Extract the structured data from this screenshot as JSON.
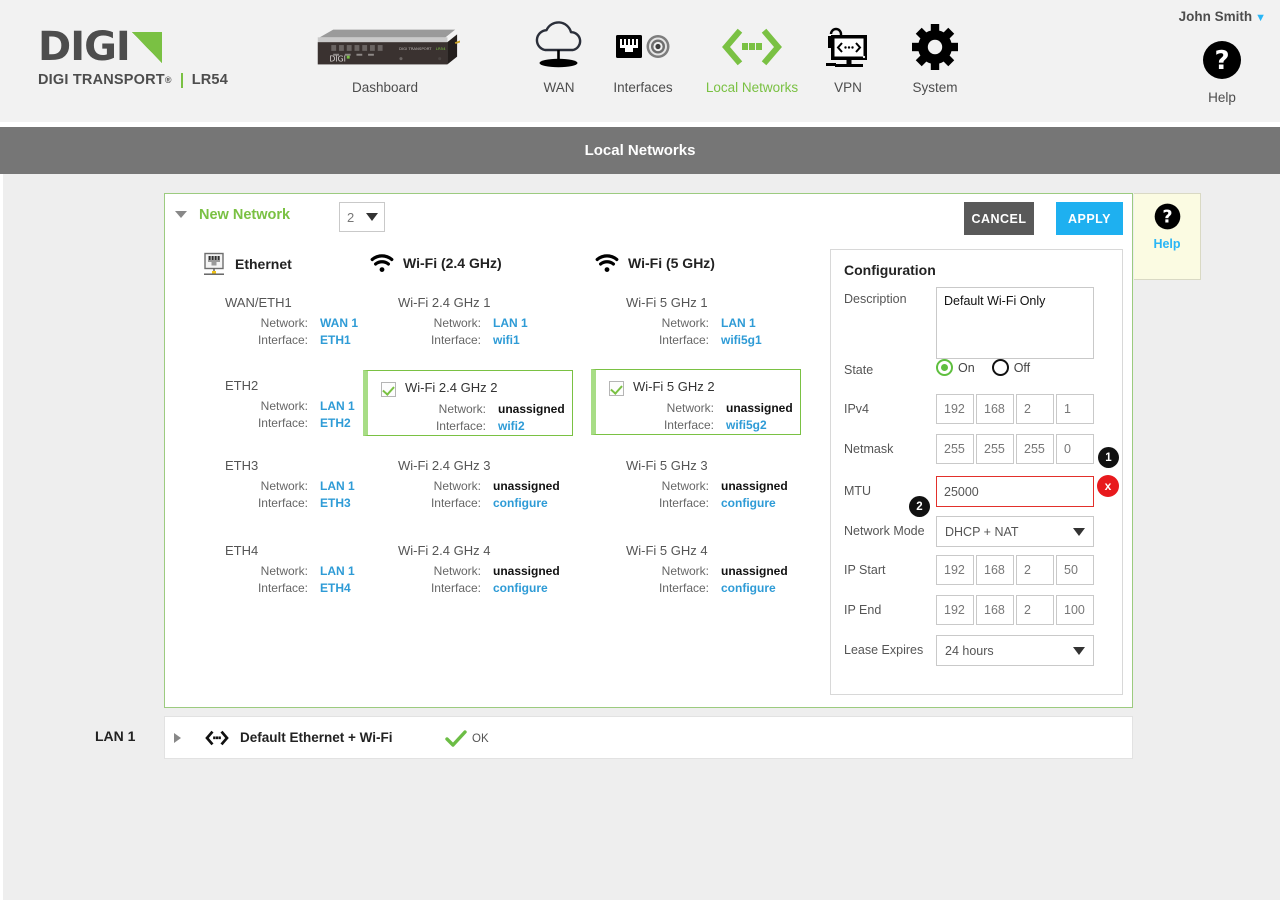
{
  "brand": {
    "word": "DIGI",
    "sub_main": "DIGI TRANSPORT",
    "sub_reg": "®",
    "sub_model": "LR54"
  },
  "header": {
    "user": "John Smith",
    "user_caret": "▼",
    "help_label": "Help",
    "help_icon": "question-circle-icon",
    "nav": [
      {
        "label": "Dashboard",
        "icon": "router-device-icon",
        "active": false
      },
      {
        "label": "WAN",
        "icon": "cloud-icon",
        "active": false
      },
      {
        "label": "Interfaces",
        "icon": "ethernet-port-icon",
        "active": false
      },
      {
        "label": "Local Networks",
        "icon": "local-network-icon",
        "active": true
      },
      {
        "label": "VPN",
        "icon": "vpn-lock-monitor-icon",
        "active": false
      },
      {
        "label": "System",
        "icon": "gear-icon",
        "active": false
      }
    ]
  },
  "page": {
    "title": "Local Networks"
  },
  "card": {
    "collapse_icon": "triangle-down-icon",
    "title": "New Network",
    "number_select": {
      "value": "2",
      "caret": "▼"
    },
    "cancel_label": "CANCEL",
    "apply_label": "APPLY",
    "help_tab": {
      "label": "Help",
      "icon": "question-circle-icon"
    }
  },
  "columns": [
    {
      "heading": "Ethernet",
      "icon": "ethernet-jack-icon",
      "items": [
        {
          "title": "WAN/ETH1",
          "selected": false,
          "fields": [
            {
              "key": "Network:",
              "value": "WAN 1",
              "style": "link"
            },
            {
              "key": "Interface:",
              "value": "ETH1",
              "style": "link"
            }
          ]
        },
        {
          "title": "ETH2",
          "selected": false,
          "fields": [
            {
              "key": "Network:",
              "value": "LAN 1",
              "style": "link"
            },
            {
              "key": "Interface:",
              "value": "ETH2",
              "style": "link"
            }
          ]
        },
        {
          "title": "ETH3",
          "selected": false,
          "fields": [
            {
              "key": "Network:",
              "value": "LAN 1",
              "style": "link"
            },
            {
              "key": "Interface:",
              "value": "ETH3",
              "style": "link"
            }
          ]
        },
        {
          "title": "ETH4",
          "selected": false,
          "fields": [
            {
              "key": "Network:",
              "value": "LAN 1",
              "style": "link"
            },
            {
              "key": "Interface:",
              "value": "ETH4",
              "style": "link"
            }
          ]
        }
      ]
    },
    {
      "heading": "Wi-Fi (2.4 GHz)",
      "icon": "wifi-icon",
      "items": [
        {
          "title": "Wi-Fi 2.4 GHz 1",
          "selected": false,
          "fields": [
            {
              "key": "Network:",
              "value": "LAN 1",
              "style": "link"
            },
            {
              "key": "Interface:",
              "value": "wifi1",
              "style": "link"
            }
          ]
        },
        {
          "title": "Wi-Fi 2.4 GHz 2",
          "selected": true,
          "fields": [
            {
              "key": "Network:",
              "value": "unassigned",
              "style": "plain"
            },
            {
              "key": "Interface:",
              "value": "wifi2",
              "style": "link"
            }
          ]
        },
        {
          "title": "Wi-Fi 2.4 GHz  3",
          "selected": false,
          "fields": [
            {
              "key": "Network:",
              "value": "unassigned",
              "style": "plain"
            },
            {
              "key": "Interface:",
              "value": "configure",
              "style": "link"
            }
          ]
        },
        {
          "title": "Wi-Fi 2.4 GHz  4",
          "selected": false,
          "fields": [
            {
              "key": "Network:",
              "value": "unassigned",
              "style": "plain"
            },
            {
              "key": "Interface:",
              "value": "configure",
              "style": "link"
            }
          ]
        }
      ]
    },
    {
      "heading": "Wi-Fi (5 GHz)",
      "icon": "wifi-icon",
      "items": [
        {
          "title": "Wi-Fi 5 GHz 1",
          "selected": false,
          "fields": [
            {
              "key": "Network:",
              "value": "LAN 1",
              "style": "link"
            },
            {
              "key": "Interface:",
              "value": "wifi5g1",
              "style": "link"
            }
          ]
        },
        {
          "title": "Wi-Fi 5 GHz 2",
          "selected": true,
          "fields": [
            {
              "key": "Network:",
              "value": "unassigned",
              "style": "plain"
            },
            {
              "key": "Interface:",
              "value": "wifi5g2",
              "style": "link"
            }
          ]
        },
        {
          "title": "Wi-Fi 5 GHz  3",
          "selected": false,
          "fields": [
            {
              "key": "Network:",
              "value": "unassigned",
              "style": "plain"
            },
            {
              "key": "Interface:",
              "value": "configure",
              "style": "link"
            }
          ]
        },
        {
          "title": "Wi-Fi 5 GHz  4",
          "selected": false,
          "fields": [
            {
              "key": "Network:",
              "value": "unassigned",
              "style": "plain"
            },
            {
              "key": "Interface:",
              "value": "configure",
              "style": "link"
            }
          ]
        }
      ]
    }
  ],
  "config": {
    "title": "Configuration",
    "description": {
      "label": "Description",
      "value": "Default Wi-Fi Only"
    },
    "state": {
      "label": "State",
      "on_label": "On",
      "off_label": "Off",
      "selected": "On"
    },
    "ipv4": {
      "label": "IPv4",
      "octets": [
        "192",
        "168",
        "2",
        "1"
      ]
    },
    "netmask": {
      "label": "Netmask",
      "octets": [
        "255",
        "255",
        "255",
        "0"
      ]
    },
    "mtu": {
      "label": "MTU",
      "value": "25000",
      "error": true,
      "error_icon": "x-error-icon",
      "error_icon_label": "x",
      "badge": "1"
    },
    "network_mode": {
      "label": "Network Mode",
      "value": "DHCP + NAT",
      "caret": "▼",
      "badge": "2"
    },
    "ip_start": {
      "label": "IP Start",
      "octets": [
        "192",
        "168",
        "2",
        "50"
      ]
    },
    "ip_end": {
      "label": "IP End",
      "octets": [
        "192",
        "168",
        "2",
        "100"
      ]
    },
    "lease_expires": {
      "label": "Lease Expires",
      "value": "24 hours",
      "caret": "▼"
    }
  },
  "lan_row": {
    "label": "LAN 1",
    "expand_icon": "triangle-right-icon",
    "network_icon": "local-network-icon",
    "name": "Default Ethernet + Wi-Fi",
    "status": "OK",
    "status_icon": "check-icon"
  },
  "colors": {
    "accent_green": "#7ac143",
    "accent_blue": "#29b6f6",
    "apply_blue": "#1eb0f0",
    "cancel_gray": "#595959",
    "titlebar_gray": "#767676",
    "error_red": "#e8191d"
  }
}
